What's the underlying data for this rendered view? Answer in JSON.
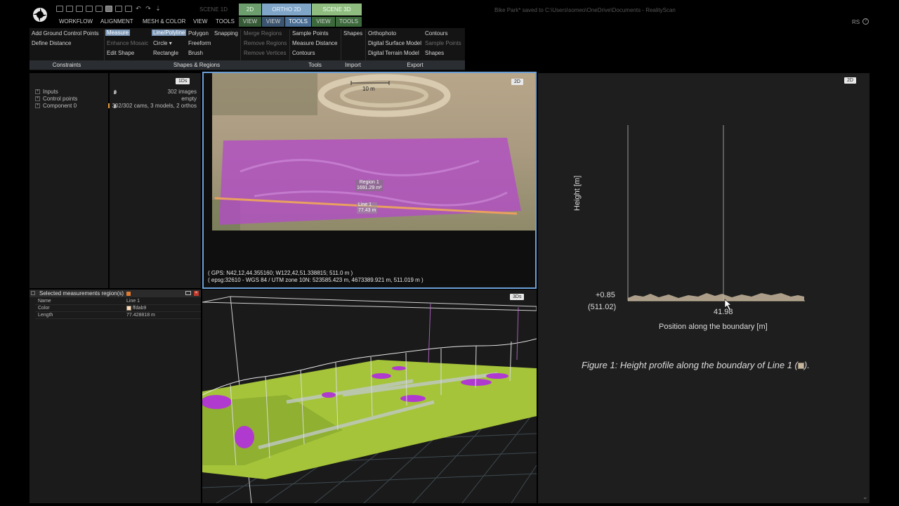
{
  "window": {
    "status_title": "Bike Park* saved to C:\\Users\\someo\\OneDrive\\Documents - RealityScan",
    "rs_mark": "RS"
  },
  "scene_tabs": {
    "scene1d": "SCENE 1D",
    "tab2d": "2D",
    "ortho2d": "ORTHO 2D",
    "scene3d": "SCENE 3D"
  },
  "menu": {
    "workflow": "WORKFLOW",
    "alignment": "ALIGNMENT",
    "mesh_color": "MESH & COLOR",
    "view": "VIEW",
    "tools": "TOOLS",
    "view_2d": "VIEW",
    "view_ortho": "VIEW",
    "tools_ortho": "TOOLS",
    "view_3d": "VIEW",
    "tools_3d": "TOOLS"
  },
  "ribbon": {
    "constraints": {
      "label": "Constraints",
      "add_gcp": "Add Ground Control Points",
      "define_distance": "Define Distance"
    },
    "shapes_regions": {
      "label": "Shapes & Regions",
      "measure": "Measure",
      "enhance_mosaic": "Enhance Mosaic",
      "edit_shape": "Edit Shape",
      "line_polyline": "Line/Polyline",
      "circle": "Circle",
      "rectangle": "Rectangle",
      "polygon": "Polygon",
      "freeform": "Freeform",
      "brush": "Brush",
      "snapping": "Snapping",
      "merge_regions": "Merge Regions",
      "remove_regions": "Remove Regions",
      "remove_vertices": "Remove Vertices"
    },
    "tools": {
      "label": "Tools",
      "sample_points": "Sample Points",
      "measure_distance": "Measure Distance",
      "contours": "Contours"
    },
    "import": {
      "label": "Import",
      "shapes": "Shapes"
    },
    "export": {
      "label": "Export",
      "orthophoto": "Orthophoto",
      "dsm": "Digital Surface Model",
      "dtm": "Digital Terrain Model",
      "contours": "Contours",
      "sample_points": "Sample Points",
      "shapes": "Shapes"
    }
  },
  "tree": {
    "badge": "1Ds",
    "items": [
      {
        "label": "Inputs",
        "value": "302 images"
      },
      {
        "label": "Control points",
        "value": "empty"
      },
      {
        "label": "Component 0",
        "value": "302/302 cams, 3 models, 2 orthos"
      }
    ]
  },
  "measurements": {
    "title": "Selected measurements region(s)",
    "rows": [
      {
        "key": "Name",
        "value": "Line 1"
      },
      {
        "key": "Color",
        "value": "ffdab9"
      },
      {
        "key": "Length",
        "value": "77.428818 m"
      }
    ]
  },
  "view2d": {
    "badge": "2D",
    "scale": "10 m",
    "region_label": "Region 1",
    "region_area": "1691.29 m²",
    "line_label": "Line 1",
    "line_length": "77.43 m",
    "gps": "( GPS: N42,12,44.355160; W122,42,51.338815; 511.0 m )",
    "epsg": "( epsg:32610 - WGS 84 / UTM zone 10N: 523585.423 m, 4673389.921 m, 511.019 m )"
  },
  "view3d": {
    "badge": "3Ds"
  },
  "graph": {
    "badge": "2D",
    "ylabel": "Height [m]",
    "xlabel": "Position along the boundary [m]",
    "y_tick_value": "+0.85",
    "y_tick_abs": "(511.02)",
    "x_tick": "41.98",
    "caption": "Figure 1: Height profile along the boundary of Line 1 (",
    "caption_end": ")."
  },
  "colors": {
    "accent_blue": "#6b9fd6",
    "region_purple": "#b24bc8",
    "line_orange": "#e9a060",
    "profile_fill": "#c5b59c"
  }
}
